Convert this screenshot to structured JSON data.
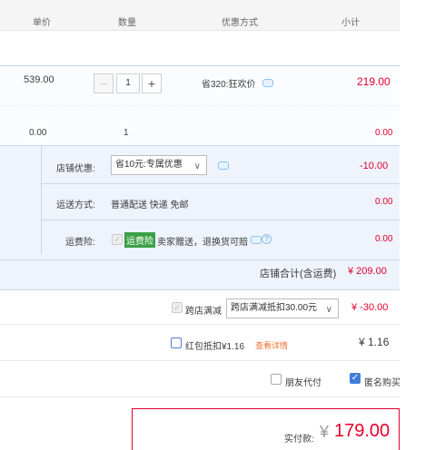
{
  "header": {
    "col_price": "单价",
    "col_qty": "数量",
    "col_discount": "优惠方式",
    "col_subtotal": "小计"
  },
  "item": {
    "unit_price": "539.00",
    "quantity": "1",
    "discount_text": "省320:狂欢价",
    "subtotal": "219.00"
  },
  "sub_item": {
    "unit_price": "0.00",
    "quantity": "1",
    "subtotal": "0.00"
  },
  "shop": {
    "discount_label": "店铺优惠:",
    "discount_select": "省10元:专属优惠",
    "discount_amount": "-10.00",
    "shipping_label": "运送方式:",
    "shipping_text": "普通配送 快递 免邮",
    "shipping_amount": "0.00",
    "insurance_label": "运费险:",
    "insurance_tag": "运费险",
    "insurance_text": "卖家赠送，退换货可赔",
    "insurance_amount": "0.00",
    "total_label": "店铺合计(含运费)",
    "total_amount": "¥ 209.00"
  },
  "cross_store": {
    "label": "跨店满减",
    "select": "跨店满减抵扣30.00元",
    "amount": "¥ -30.00"
  },
  "red_packet": {
    "label": "红包抵扣¥1.16",
    "link": "查看详情",
    "amount": "¥ 1.16"
  },
  "options": {
    "friend_pay": "朋友代付",
    "anonymous": "匿名购买"
  },
  "payment": {
    "label": "实付款:",
    "currency": "¥",
    "amount": "179.00"
  },
  "colors": {
    "accent_red": "#e4002b",
    "blue_border": "#c7daf0",
    "check_blue": "#3f7fd8",
    "tag_green": "#3c9f46"
  },
  "icons": {
    "minus": "−",
    "plus": "+",
    "chevron": "chevron-down-icon",
    "check": "✓"
  }
}
